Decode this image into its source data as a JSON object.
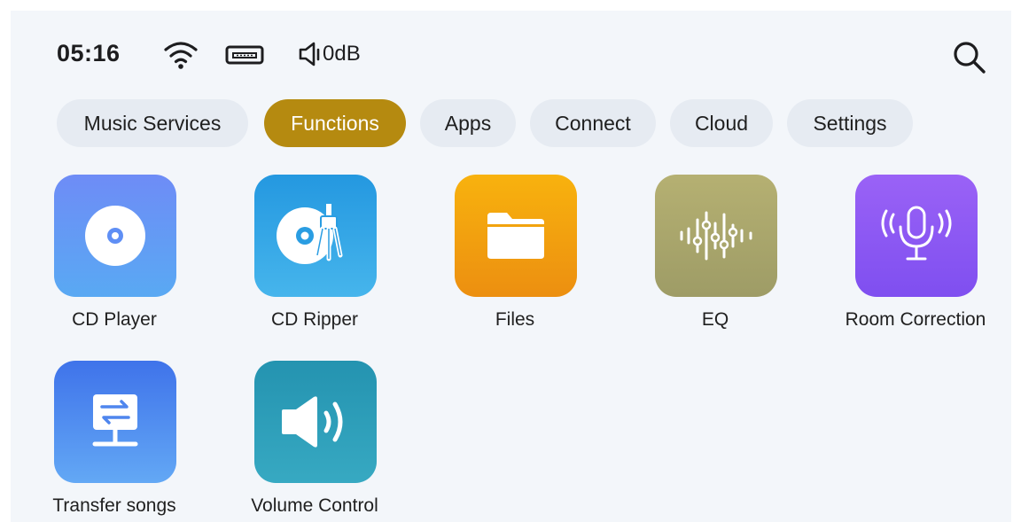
{
  "status": {
    "time": "05:16",
    "volume": "0dB",
    "icons": [
      "wifi-icon",
      "usb-icon",
      "speaker-icon",
      "search-icon"
    ]
  },
  "tabs": [
    {
      "label": "Music Services",
      "active": false
    },
    {
      "label": "Functions",
      "active": true
    },
    {
      "label": "Apps",
      "active": false
    },
    {
      "label": "Connect",
      "active": false
    },
    {
      "label": "Cloud",
      "active": false
    },
    {
      "label": "Settings",
      "active": false
    }
  ],
  "apps": [
    {
      "label": "CD Player",
      "icon": "cd-icon",
      "color": "#5f9af5"
    },
    {
      "label": "CD Ripper",
      "icon": "cd-ripper-icon",
      "color": "#2d9fe3"
    },
    {
      "label": "Files",
      "icon": "folder-icon",
      "color": "#f2a30e"
    },
    {
      "label": "EQ",
      "icon": "equalizer-icon",
      "color": "#a9a66c"
    },
    {
      "label": "Room Correction",
      "icon": "microphone-icon",
      "color": "#8f59f3"
    },
    {
      "label": "Transfer songs",
      "icon": "transfer-icon",
      "color": "#4f86ee"
    },
    {
      "label": "Volume Control",
      "icon": "volume-icon",
      "color": "#2a9bb5"
    }
  ],
  "colors": {
    "accent": "#b58a10",
    "tab_bg": "#e6ebf2",
    "screen_bg": "#f3f6fa"
  }
}
